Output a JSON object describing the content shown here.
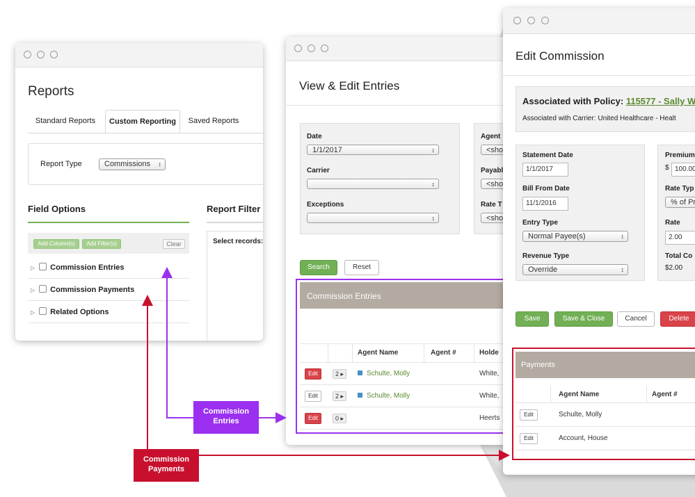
{
  "reports": {
    "title": "Reports",
    "tabs": [
      "Standard Reports",
      "Custom Reporting",
      "Saved Reports"
    ],
    "report_type_label": "Report Type",
    "report_type_value": "Commissions",
    "field_options_title": "Field Options",
    "report_filter_title": "Report Filter",
    "add_columns_label": "Add Column(s)",
    "add_filters_label": "Add Filter(s)",
    "clear_label": "Clear",
    "select_records_label": "Select records:",
    "options": [
      "Commission Entries",
      "Commission Payments",
      "Related Options"
    ]
  },
  "view_edit": {
    "title": "View & Edit Entries",
    "date_label": "Date",
    "date_value": "1/1/2017",
    "carrier_label": "Carrier",
    "carrier_value": "",
    "exceptions_label": "Exceptions",
    "exceptions_value": "",
    "agent_label": "Agent",
    "agent_value": "<sho",
    "payable_label": "Payabl",
    "payable_value": "<sho",
    "rate_label": "Rate T",
    "rate_value": "<sho",
    "search_label": "Search",
    "reset_label": "Reset",
    "panel_title": "Commission Entries",
    "columns": [
      "Agent Name",
      "Agent #",
      "Holde"
    ],
    "rows": [
      {
        "edit": "Edit",
        "edit_style": "red",
        "count": "2 ▸",
        "agent": "Schulte, Molly",
        "holder": "White,"
      },
      {
        "edit": "Edit",
        "edit_style": "white",
        "count": "2 ▸",
        "agent": "Schulte, Molly",
        "holder": "White,"
      },
      {
        "edit": "Edit",
        "edit_style": "red",
        "count": "0 ▸",
        "agent": "",
        "holder": "Heerts"
      }
    ]
  },
  "edit_commission": {
    "title": "Edit Commission",
    "policy_label": "Associated with Policy:",
    "policy_link": "115577 - Sally W",
    "carrier_text": "Associated with Carrier: United Healthcare - Healt",
    "statement_date_label": "Statement Date",
    "statement_date_value": "1/1/2017",
    "bill_from_label": "Bill From Date",
    "bill_from_value": "11/1/2016",
    "entry_type_label": "Entry Type",
    "entry_type_value": "Normal Payee(s)",
    "revenue_type_label": "Revenue Type",
    "revenue_type_value": "Override",
    "premium_label": "Premium",
    "premium_currency": "$",
    "premium_value": "100.00",
    "rate_type_label": "Rate Typ",
    "rate_type_value": "% of Pr",
    "rate_label": "Rate",
    "rate_value": "2.00",
    "total_label": "Total Co",
    "total_value": "$2.00",
    "save_label": "Save",
    "save_close_label": "Save & Close",
    "cancel_label": "Cancel",
    "delete_label": "Delete",
    "payments_title": "Payments",
    "columns": [
      "Agent Name",
      "Agent #"
    ],
    "rows": [
      {
        "edit": "Edit",
        "agent": "Schulte, Molly"
      },
      {
        "edit": "Edit",
        "agent": "Account, House"
      }
    ]
  },
  "callouts": {
    "entries": "Commission Entries",
    "payments": "Commission Payments"
  },
  "colors": {
    "green": "#72b055",
    "red_button": "#d9434a",
    "purple": "#9b30f0",
    "dark_red": "#c8102e",
    "panel_header": "#b3aaa1"
  }
}
